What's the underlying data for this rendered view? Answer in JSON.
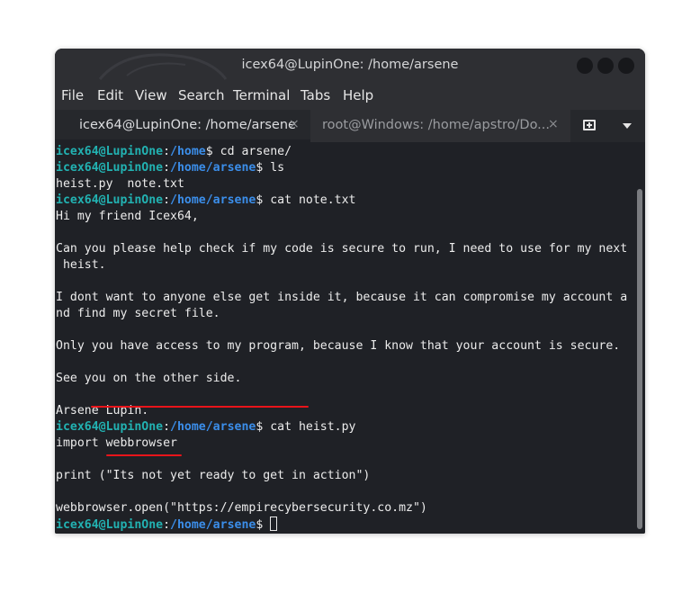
{
  "window": {
    "title": "icex64@LupinOne: /home/arsene"
  },
  "menu": [
    "File",
    "Edit",
    "View",
    "Search",
    "Terminal",
    "Tabs",
    "Help"
  ],
  "tabs": [
    {
      "label": "icex64@LupinOne: /home/arsene",
      "close": "×",
      "active": true
    },
    {
      "label": "root@Windows: /home/apstro/Do...",
      "close": "×",
      "active": false
    }
  ],
  "prompt": {
    "user": "icex64@LupinOne",
    "sep": ":",
    "path_home": "/home",
    "path_arsene": "/home/arsene",
    "sign": "$"
  },
  "terminal": {
    "cmd1": " cd arsene/",
    "cmd2": " ls",
    "ls_out": "heist.py  note.txt",
    "cmd3": " cat note.txt",
    "note": [
      "Hi my friend Icex64,",
      "",
      "Can you please help check if my code is secure to run, I need to use for my next",
      " heist.",
      "",
      "I dont want to anyone else get inside it, because it can compromise my account a",
      "nd find my secret file.",
      "",
      "Only you have access to my program, because I know that your account is secure.",
      "",
      "See you on the other side.",
      "",
      "Arsene Lupin."
    ],
    "cmd4": " cat heist.py",
    "heist": [
      "import webbrowser",
      "",
      "print (\"Its not yet ready to get in action\")",
      "",
      "webbrowser.open(\"https://empirecybersecurity.co.mz\")"
    ]
  },
  "colors": {
    "prompt_user": "#22b2b2",
    "prompt_path": "#3b8eea",
    "annotation": "#e8141a",
    "background": "#1f2126"
  },
  "icons": [
    "new-tab-icon",
    "chevron-down-icon",
    "close-icon"
  ]
}
